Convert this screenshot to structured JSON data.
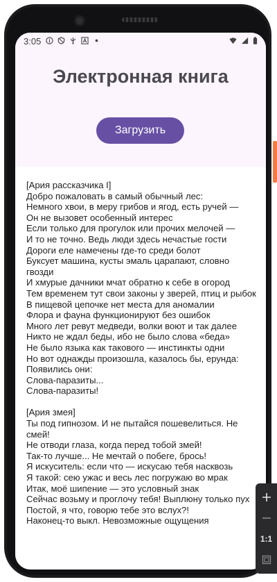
{
  "status_bar": {
    "time": "3:05",
    "left_icons": [
      "info-icon",
      "shield-icon",
      "usb-icon",
      "a-box-icon",
      "dot-icon"
    ],
    "right_icons": [
      "wifi-icon",
      "cell-signal-icon",
      "battery-icon"
    ]
  },
  "app": {
    "title": "Электронная книга",
    "load_button": "Загрузить",
    "accent_color": "#6750a4",
    "header_bg": "#fdf5fe"
  },
  "book_lines": [
    "[Ария рассказчика I]",
    "Добро пожаловать в самый обычный лес:",
    "Немного хвои, в меру грибов и ягод, есть ручей —",
    "Он не вызовет особенный интерес",
    "Если только для прогулок или прочих мелочей —",
    "И то не точно. Ведь люди здесь нечастые гости",
    "Дороги еле намечены где-то среди болот",
    "Буксует машина, кусты эмаль царапают, словно гвозди",
    "И хмурые дачники мчат обратно к себе в огород",
    "Тем временем тут свои законы у зверей, птиц и рыбок",
    "В пищевой цепочке нет места для аномалии",
    "Флора и фауна функционируют без ошибок",
    "Много лет ревут медведи, волки воют и так далее",
    "Никто не ждал беды, ибо не было слова «беда»",
    "Не было языка как такового — инстинкты одни",
    "Но вот однажды произошла, казалось бы, ерунда:",
    "Появились они:",
    "Слова-паразиты...",
    "Слова-паразиты!",
    "",
    "[Ария змея]",
    "Ты под гипнозом. И не пытайся пошевелиться. Не смей!",
    "Не отводи глаза, когда перед тобой змей!",
    "Так-то лучше... Не мечтай о побеге, брось!",
    "Я искуситель: если что — искусаю тебя насквозь",
    "Я такой: сею ужас и весь лес погружаю во мрак",
    "Итак, моё шипение — это условный знак",
    "Сейчас возьму и проглочу тебя! Выплюну только пух",
    "Постой, я что, говорю тебе это вслух?!",
    "Наконец-то выкл. Невозможные ощущения"
  ],
  "emulator_toolbar": {
    "items": [
      "plus-icon",
      "minus-icon",
      "1:1",
      "fit-screen-icon"
    ],
    "ratio_label": "1:1"
  }
}
